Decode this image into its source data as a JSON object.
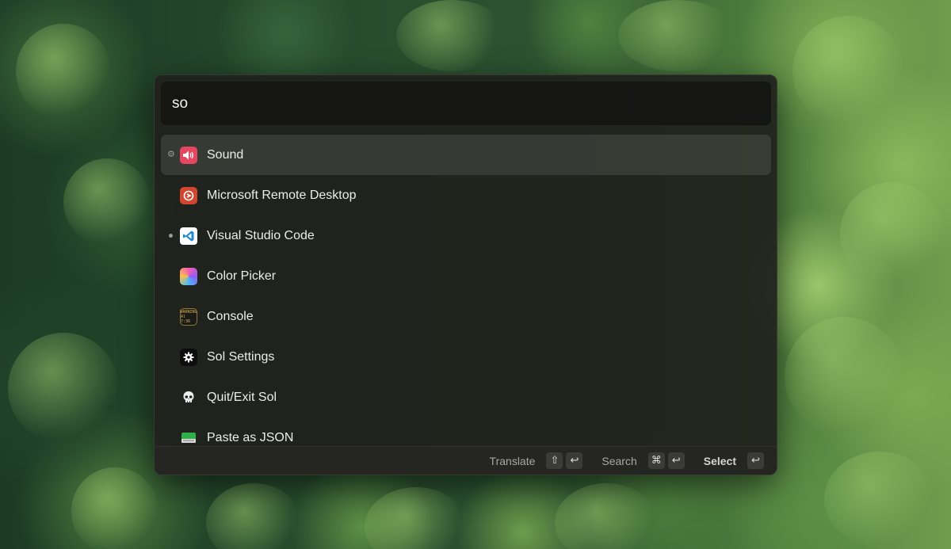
{
  "search": {
    "value": "so"
  },
  "results": [
    {
      "label": "Sound",
      "icon": "speaker-icon",
      "marker": "gear",
      "selected": true
    },
    {
      "label": "Microsoft Remote Desktop",
      "icon": "remote-desktop-icon",
      "marker": "none",
      "selected": false
    },
    {
      "label": "Visual Studio Code",
      "icon": "vscode-icon",
      "marker": "dot",
      "selected": false
    },
    {
      "label": "Color Picker",
      "icon": "color-picker-icon",
      "marker": "none",
      "selected": false
    },
    {
      "label": "Console",
      "icon": "console-icon",
      "marker": "none",
      "selected": false
    },
    {
      "label": "Sol Settings",
      "icon": "gear-icon",
      "marker": "none",
      "selected": false
    },
    {
      "label": "Quit/Exit Sol",
      "icon": "skull-icon",
      "marker": "none",
      "selected": false
    },
    {
      "label": "Paste as JSON",
      "icon": "clipboard-icon",
      "marker": "none",
      "selected": false
    }
  ],
  "footer": {
    "translate_label": "Translate",
    "search_label": "Search",
    "select_label": "Select",
    "shift_key": "⇧",
    "cmd_key": "⌘",
    "return_key": "↩"
  },
  "console_icon_text": {
    "line1": "WARNING",
    "line2": "Al 7:36"
  },
  "colors": {
    "panel_bg": "#20201c",
    "selected_row": "#3a3a36",
    "text": "#ececec",
    "muted": "#a9a9a4"
  }
}
